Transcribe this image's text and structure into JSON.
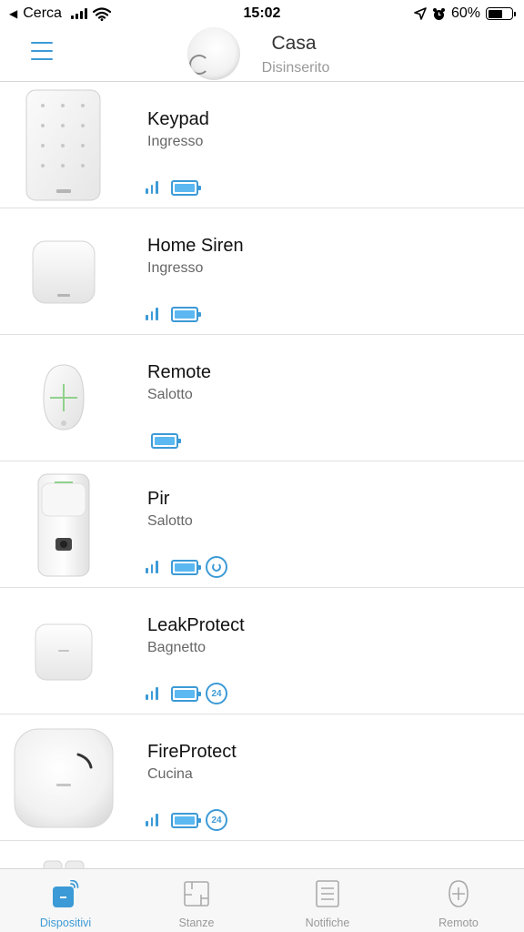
{
  "status_bar": {
    "back_label": "Cerca",
    "time": "15:02",
    "battery_percent": "60%",
    "battery_level": 0.6
  },
  "header": {
    "title": "Casa",
    "status": "Disinserito"
  },
  "devices": [
    {
      "name": "Keypad",
      "room": "Ingresso",
      "signal": true,
      "battery": true,
      "badge": ""
    },
    {
      "name": "Home Siren",
      "room": "Ingresso",
      "signal": true,
      "battery": true,
      "badge": ""
    },
    {
      "name": "Remote",
      "room": "Salotto",
      "signal": false,
      "battery": true,
      "badge": ""
    },
    {
      "name": "Pir",
      "room": "Salotto",
      "signal": true,
      "battery": true,
      "badge": "ring"
    },
    {
      "name": "LeakProtect",
      "room": "Bagnetto",
      "signal": true,
      "battery": true,
      "badge": "24"
    },
    {
      "name": "FireProtect",
      "room": "Cucina",
      "signal": true,
      "battery": true,
      "badge": "24"
    }
  ],
  "tabs": [
    {
      "label": "Dispositivi",
      "icon": "devices-icon",
      "active": true
    },
    {
      "label": "Stanze",
      "icon": "rooms-icon",
      "active": false
    },
    {
      "label": "Notifiche",
      "icon": "notifications-icon",
      "active": false
    },
    {
      "label": "Remoto",
      "icon": "remote-icon",
      "active": false
    }
  ],
  "colors": {
    "accent": "#3c9ad6",
    "battery_fill": "#5cb8f0",
    "inactive_tab": "#999999"
  }
}
